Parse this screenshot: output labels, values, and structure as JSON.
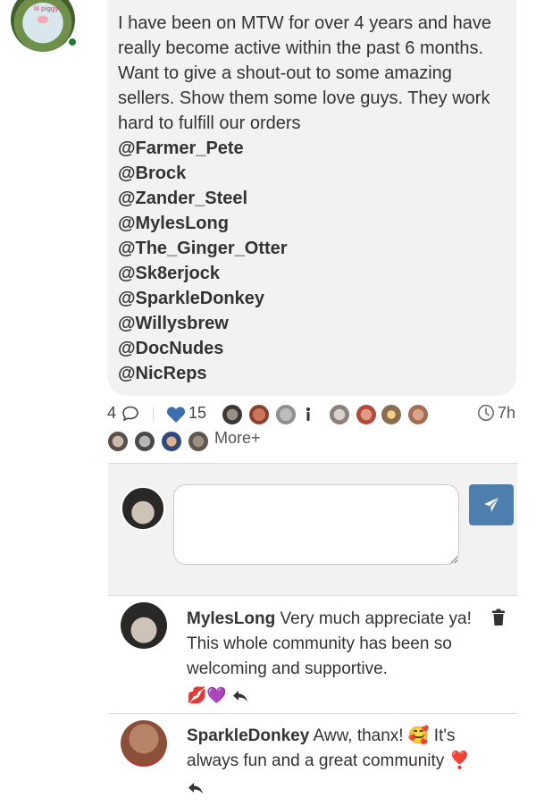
{
  "post": {
    "author_avatar_text": "lil piggy",
    "body": "I have been on MTW for over 4 years and have really become active within the past 6 months. Want to give a shout-out to some amazing sellers. Show them some love guys. They work hard to fulfill our orders",
    "mentions": [
      "@Farmer_Pete",
      "@Brock",
      "@Zander_Steel",
      "@MylesLong",
      "@The_Ginger_Otter",
      "@Sk8erjock",
      "@SparkleDonkey",
      "@Willysbrew",
      "@DocNudes",
      "@NicReps"
    ]
  },
  "stats": {
    "comment_count": "4",
    "like_count": "15",
    "time_ago": "7h",
    "more_label": "More+"
  },
  "compose": {
    "placeholder": ""
  },
  "comments": [
    {
      "user": "MylesLong",
      "text": "Very much appreciate ya! This whole community has been so welcoming and supportive.",
      "reactions": "💋💜"
    },
    {
      "user": "SparkleDonkey",
      "text": "Aww, thanx! 🥰 It's always fun and a great community ❣️",
      "reactions": ""
    }
  ],
  "colors": {
    "bubble_bg": "#f2f2f2",
    "accent_blue": "#4f7fae",
    "online_green": "#1f7a32",
    "heart_blue": "#3b6fb0"
  }
}
